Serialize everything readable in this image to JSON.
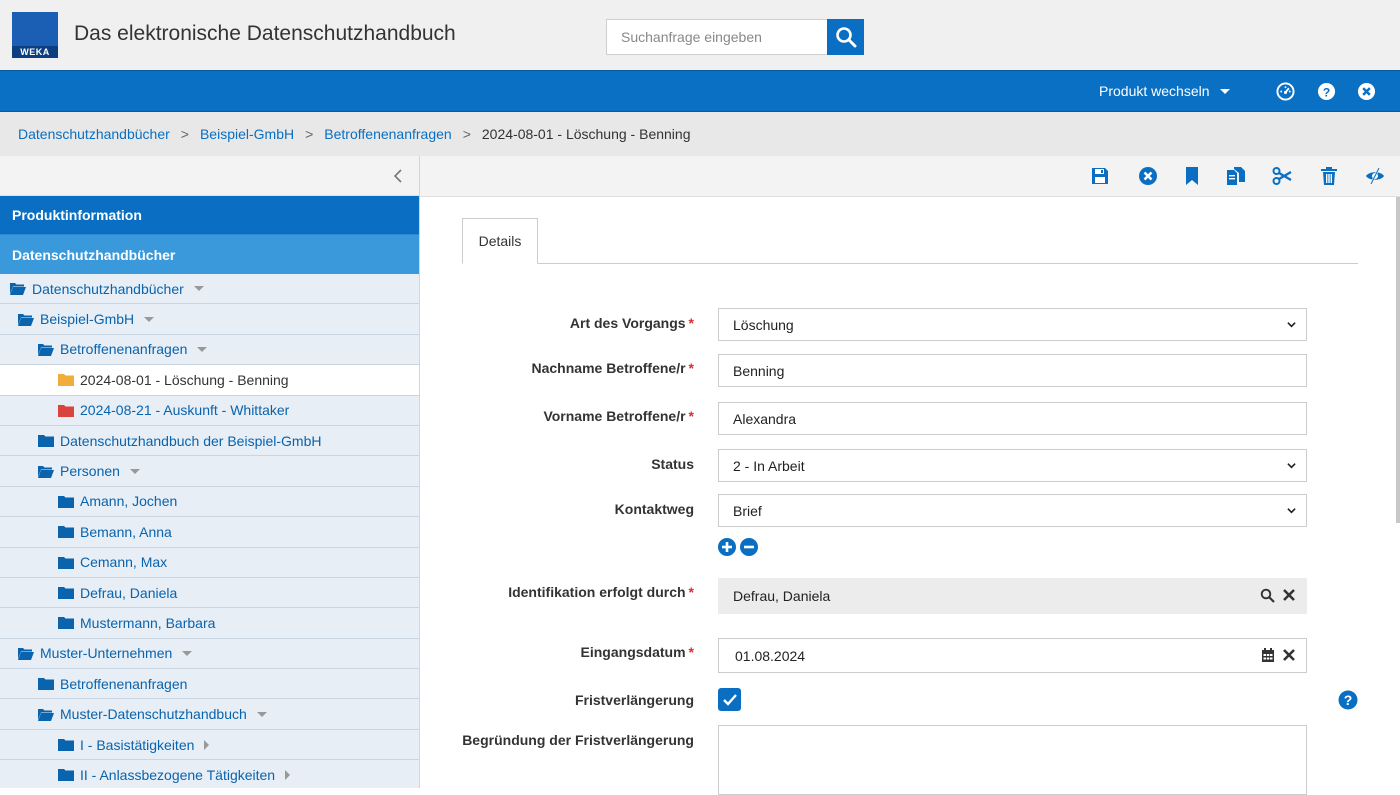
{
  "header": {
    "logo_text": "WEKA",
    "app_title": "Das elektronische Datenschutzhandbuch",
    "search_placeholder": "Suchanfrage eingeben"
  },
  "bluebar": {
    "product_switch_label": "Produkt wechseln",
    "icons": [
      "dashboard-icon",
      "help-icon",
      "close-icon"
    ]
  },
  "breadcrumb": {
    "items": [
      "Datenschutzhandbücher",
      "Beispiel-GmbH",
      "Betroffenenanfragen"
    ],
    "separator": ">",
    "current": "2024-08-01 - Löschung - Benning"
  },
  "sidebar": {
    "section1": "Produktinformation",
    "section2": "Datenschutzhandbücher",
    "tree": [
      {
        "label": "Datenschutzhandbücher",
        "level": 0,
        "icon": "folder-open-icon",
        "marker": "dropdown"
      },
      {
        "label": "Beispiel-GmbH",
        "level": 1,
        "icon": "folder-open-icon",
        "marker": "dropdown"
      },
      {
        "label": "Betroffenenanfragen",
        "level": 2,
        "icon": "folder-open-icon",
        "marker": "dropdown"
      },
      {
        "label": "2024-08-01 - Löschung - Benning",
        "level": 3,
        "icon": "folder-icon",
        "color": "#f0ad3c",
        "active": true
      },
      {
        "label": "2024-08-21 - Auskunft - Whittaker",
        "level": 3,
        "icon": "folder-icon",
        "color": "#d9453c"
      },
      {
        "label": "Datenschutzhandbuch der Beispiel-GmbH",
        "level": 2,
        "icon": "folder-icon"
      },
      {
        "label": "Personen",
        "level": 2,
        "icon": "folder-open-icon",
        "marker": "dropdown"
      },
      {
        "label": "Amann, Jochen",
        "level": 3,
        "icon": "folder-icon"
      },
      {
        "label": "Bemann, Anna",
        "level": 3,
        "icon": "folder-icon"
      },
      {
        "label": "Cemann, Max",
        "level": 3,
        "icon": "folder-icon"
      },
      {
        "label": "Defrau, Daniela",
        "level": 3,
        "icon": "folder-icon"
      },
      {
        "label": "Mustermann, Barbara",
        "level": 3,
        "icon": "folder-icon"
      },
      {
        "label": "Muster-Unternehmen",
        "level": 1,
        "icon": "folder-open-icon",
        "marker": "dropdown"
      },
      {
        "label": "Betroffenenanfragen",
        "level": 2,
        "icon": "folder-icon"
      },
      {
        "label": "Muster-Datenschutzhandbuch",
        "level": 2,
        "icon": "folder-open-icon",
        "marker": "dropdown"
      },
      {
        "label": "I - Basistätigkeiten",
        "level": 3,
        "icon": "folder-icon",
        "marker": "right"
      },
      {
        "label": "II - Anlassbezogene Tätigkeiten",
        "level": 3,
        "icon": "folder-icon",
        "marker": "right"
      }
    ]
  },
  "toolbar": {
    "icons": [
      "save-icon",
      "cancel-icon",
      "bookmark-icon",
      "copy-icon",
      "cut-icon",
      "delete-icon",
      "visibility-icon"
    ]
  },
  "form": {
    "tab_label": "Details",
    "art_label": "Art des Vorgangs",
    "art_value": "Löschung",
    "nachname_label": "Nachname Betroffene/r",
    "nachname_value": "Benning",
    "vorname_label": "Vorname Betroffene/r",
    "vorname_value": "Alexandra",
    "status_label": "Status",
    "status_value": "2 - In Arbeit",
    "kontakt_label": "Kontaktweg",
    "kontakt_value": "Brief",
    "ident_label": "Identifikation erfolgt durch",
    "ident_value": "Defrau, Daniela",
    "eingang_label": "Eingangsdatum",
    "eingang_value": "01.08.2024",
    "frist_label": "Fristverlängerung",
    "frist_checked": true,
    "begruendung_label": "Begründung der Fristverlängerung",
    "required_marker": "*"
  },
  "colors": {
    "brand_blue": "#0a6fc2",
    "light_blue": "#3a99db",
    "required_red": "#d9302c"
  }
}
